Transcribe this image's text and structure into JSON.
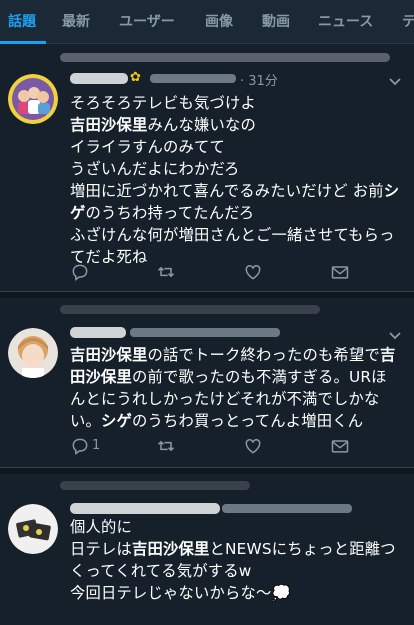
{
  "tabs": [
    {
      "label": "話題",
      "active": true
    },
    {
      "label": "最新",
      "active": false
    },
    {
      "label": "ユーザー",
      "active": false
    },
    {
      "label": "画像",
      "active": false
    },
    {
      "label": "動画",
      "active": false
    },
    {
      "label": "ニュース",
      "active": false
    },
    {
      "label": "テ",
      "active": false
    }
  ],
  "tweets": [
    {
      "time": "· 31分",
      "handle_prefix": "@",
      "lines": [
        [
          {
            "t": "そろそろテレビも気づけよ"
          }
        ],
        [
          {
            "t": "吉田沙保里",
            "b": true
          },
          {
            "t": "みんな嫌いなの"
          }
        ],
        [
          {
            "t": "イライラすんのみてて"
          }
        ],
        [
          {
            "t": "うざいんだよにわかだろ"
          }
        ],
        [
          {
            "t": "増田に近づかれて喜んでるみたいだけど お前"
          },
          {
            "t": "シ",
            "b": true
          }
        ],
        [
          {
            "t": "ゲ",
            "b": true
          },
          {
            "t": "のうちわ持ってたんだろ"
          }
        ],
        [
          {
            "t": "ふざけんな何が増田さんとご一緒させてもらっ"
          }
        ],
        [
          {
            "t": "てだよ死ね"
          }
        ]
      ],
      "reply_count": "",
      "retweet_count": "",
      "like_count": ""
    },
    {
      "time": "",
      "handle_prefix": "",
      "lines": [
        [
          {
            "t": "吉田沙保里",
            "b": true
          },
          {
            "t": "の話でトーク終わったのも希望で"
          },
          {
            "t": "吉",
            "b": true
          }
        ],
        [
          {
            "t": "田沙保里",
            "b": true
          },
          {
            "t": "の前で歌ったのも不満すぎる。URほ"
          }
        ],
        [
          {
            "t": "んとにうれしかったけどそれが不満でしかな"
          }
        ],
        [
          {
            "t": "い。"
          },
          {
            "t": "シゲ",
            "b": true
          },
          {
            "t": "のうちわ買っとってんよ増田くん"
          }
        ]
      ],
      "reply_count": "1",
      "retweet_count": "",
      "like_count": ""
    },
    {
      "time": "",
      "handle_prefix": "",
      "lines": [
        [
          {
            "t": "個人的に"
          }
        ],
        [
          {
            "t": "日テレは"
          },
          {
            "t": "吉田沙保里",
            "b": true
          },
          {
            "t": "とNEWSにちょっと距離つ"
          }
        ],
        [
          {
            "t": "くってくれてる気がするw"
          }
        ],
        [
          {
            "t": "今回日テレじゃないからな〜💭"
          }
        ]
      ],
      "reply_count": "",
      "retweet_count": "",
      "like_count": ""
    }
  ],
  "icons": {
    "reply": "reply-icon",
    "retweet": "retweet-icon",
    "like": "heart-icon",
    "dm": "mail-icon",
    "more": "chevron-down-icon"
  },
  "colors": {
    "background": "#15202b",
    "accent": "#1da1f2",
    "secondary_text": "#8899a6"
  }
}
